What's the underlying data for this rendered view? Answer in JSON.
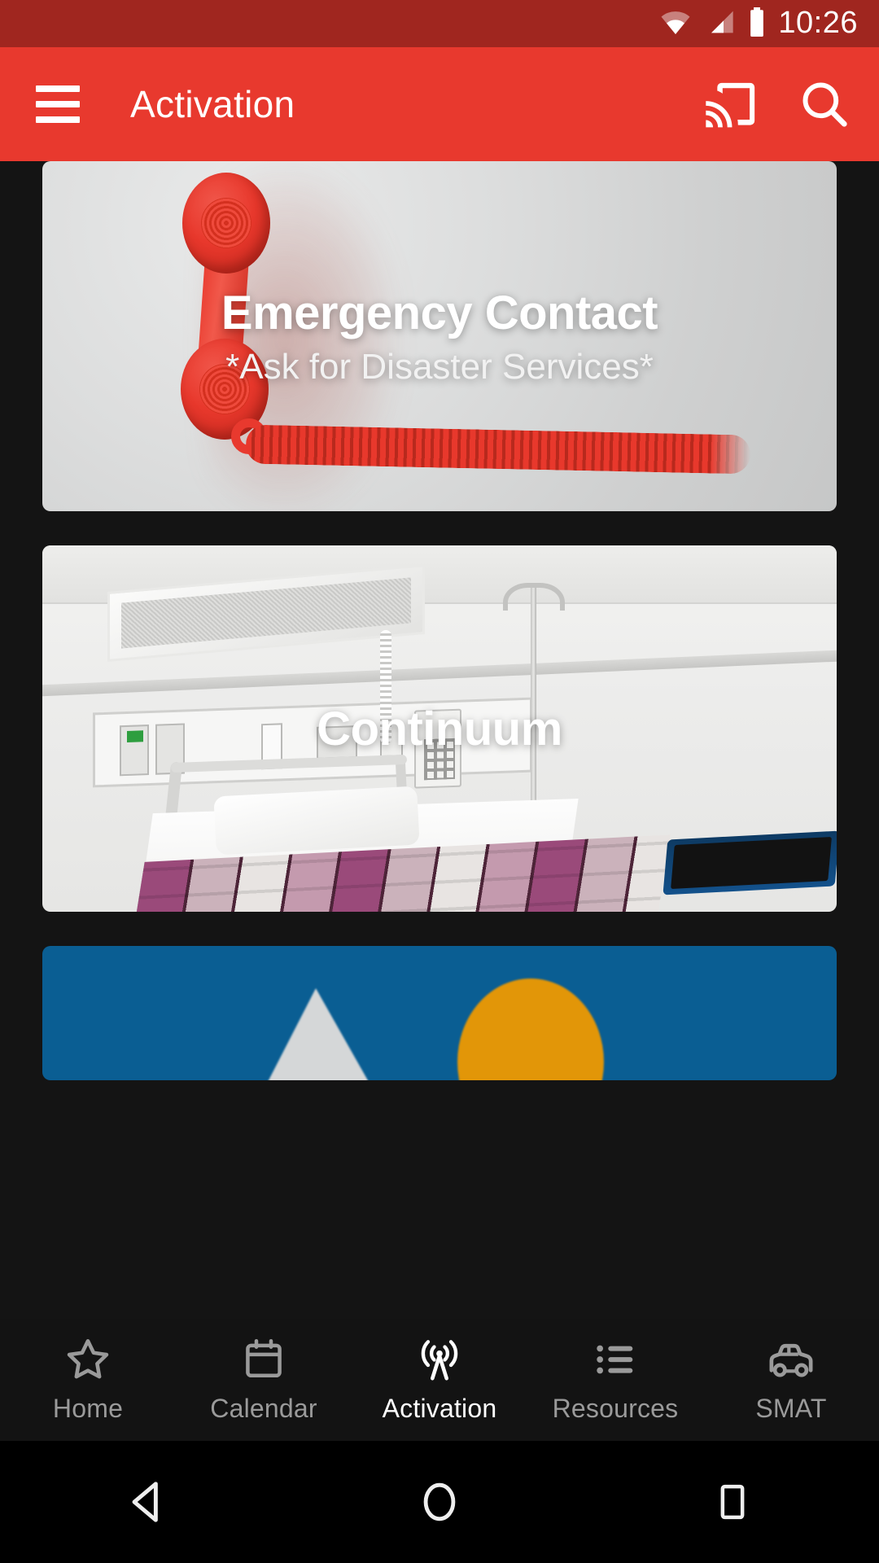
{
  "status_bar": {
    "time": "10:26",
    "icons": [
      "wifi-icon",
      "cellular-signal-icon",
      "battery-icon"
    ],
    "background_color": "#A0261F"
  },
  "app_bar": {
    "title": "Activation",
    "menu_icon": "hamburger-menu-icon",
    "actions": [
      {
        "name": "cast-icon",
        "label": "Cast"
      },
      {
        "name": "search-icon",
        "label": "Search"
      }
    ],
    "background_color": "#E8392E"
  },
  "cards": [
    {
      "id": "emergency-contact",
      "title": "Emergency Contact",
      "subtitle": "*Ask for Disaster Services*",
      "image": "red-telephone-handset-on-grey-wall"
    },
    {
      "id": "continuum",
      "title": "Continuum",
      "subtitle": "",
      "image": "hospital-room-with-bed"
    },
    {
      "id": "blue-poster",
      "title": "",
      "subtitle": "",
      "image": "blue-poster-with-mountain-and-sun"
    }
  ],
  "bottom_nav": {
    "active": "Activation",
    "items": [
      {
        "label": "Home",
        "icon": "star-icon"
      },
      {
        "label": "Calendar",
        "icon": "calendar-icon"
      },
      {
        "label": "Activation",
        "icon": "broadcast-tower-icon"
      },
      {
        "label": "Resources",
        "icon": "bulleted-list-icon"
      },
      {
        "label": "SMAT",
        "icon": "car-icon"
      }
    ]
  },
  "system_nav": {
    "items": [
      {
        "name": "back-button",
        "icon": "triangle-left-icon"
      },
      {
        "name": "home-button",
        "icon": "circle-icon"
      },
      {
        "name": "recents-button",
        "icon": "square-icon"
      }
    ]
  }
}
